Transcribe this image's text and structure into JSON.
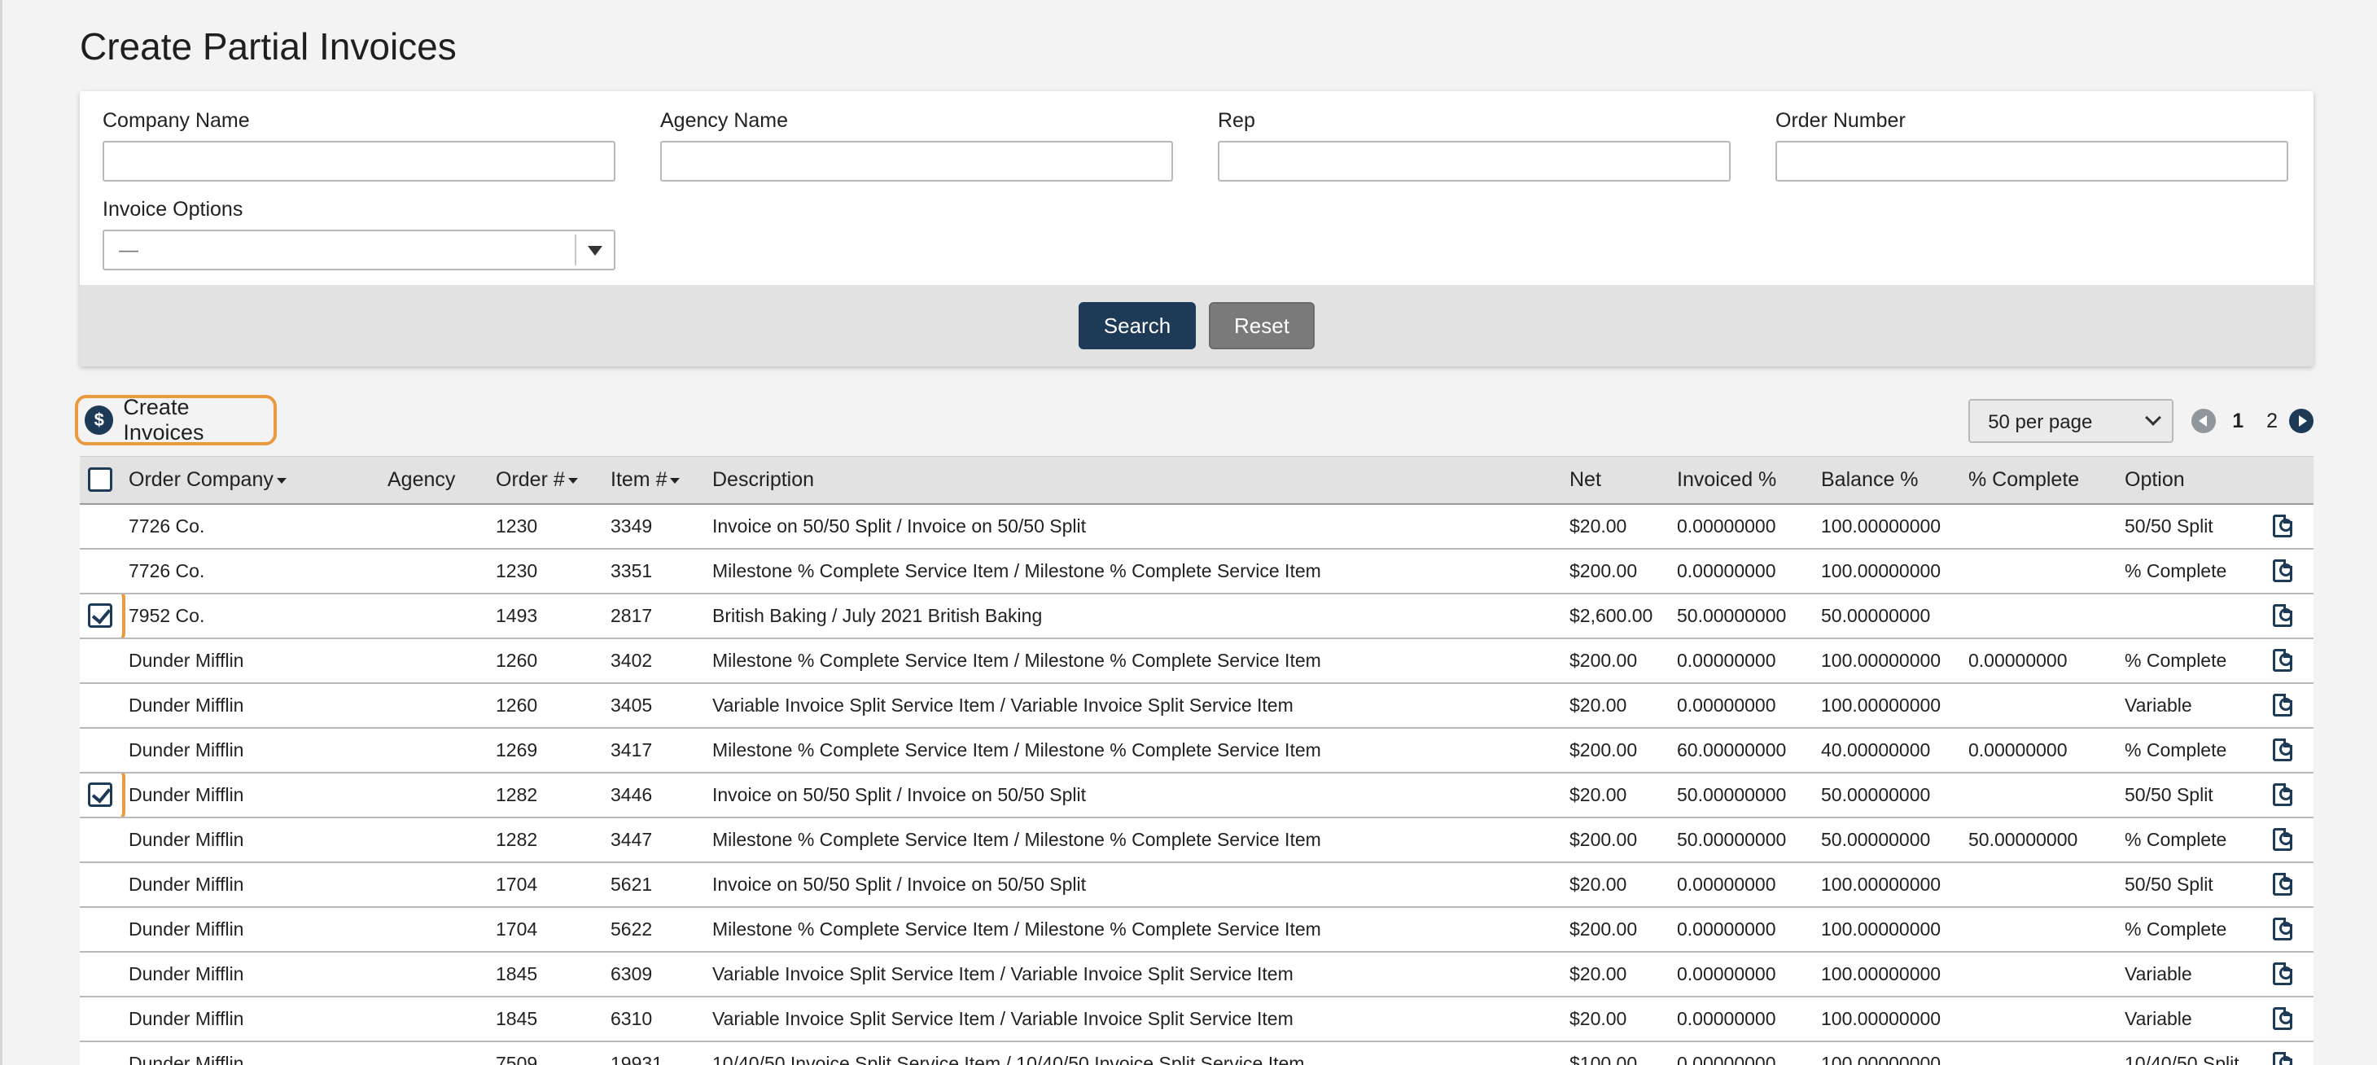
{
  "page": {
    "title": "Create Partial Invoices"
  },
  "search_form": {
    "fields": [
      {
        "label": "Company Name",
        "value": "",
        "placeholder": ""
      },
      {
        "label": "Agency Name",
        "value": "",
        "placeholder": ""
      },
      {
        "label": "Rep",
        "value": "",
        "placeholder": ""
      },
      {
        "label": "Order Number",
        "value": "",
        "placeholder": ""
      }
    ],
    "invoice_options": {
      "label": "Invoice Options",
      "selected": "—"
    },
    "search_label": "Search",
    "reset_label": "Reset"
  },
  "toolbar": {
    "create_invoices_label": "Create Invoices",
    "per_page": "50 per page",
    "pages": [
      "1",
      "2"
    ],
    "current_page": "1"
  },
  "table": {
    "headers": [
      "Order Company",
      "Agency",
      "Order #",
      "Item #",
      "Description",
      "Net",
      "Invoiced %",
      "Balance %",
      "% Complete",
      "Option"
    ],
    "rows": [
      {
        "checked": false,
        "company": "7726 Co.",
        "agency": "",
        "order": "1230",
        "item": "3349",
        "description": "Invoice on 50/50 Split / Invoice on 50/50 Split",
        "net": "$20.00",
        "invoiced": "0.00000000",
        "balance": "100.00000000",
        "complete": "",
        "option": "50/50 Split"
      },
      {
        "checked": false,
        "company": "7726 Co.",
        "agency": "",
        "order": "1230",
        "item": "3351",
        "description": "Milestone % Complete Service Item / Milestone % Complete Service Item",
        "net": "$200.00",
        "invoiced": "0.00000000",
        "balance": "100.00000000",
        "complete": "",
        "option": "% Complete"
      },
      {
        "checked": true,
        "company": "7952 Co.",
        "agency": "",
        "order": "1493",
        "item": "2817",
        "description": "British Baking / July 2021 British Baking",
        "net": "$2,600.00",
        "invoiced": "50.00000000",
        "balance": "50.00000000",
        "complete": "",
        "option": ""
      },
      {
        "checked": false,
        "company": "Dunder Mifflin",
        "agency": "",
        "order": "1260",
        "item": "3402",
        "description": "Milestone % Complete Service Item / Milestone % Complete Service Item",
        "net": "$200.00",
        "invoiced": "0.00000000",
        "balance": "100.00000000",
        "complete": "0.00000000",
        "option": "% Complete"
      },
      {
        "checked": false,
        "company": "Dunder Mifflin",
        "agency": "",
        "order": "1260",
        "item": "3405",
        "description": "Variable Invoice Split Service Item / Variable Invoice Split Service Item",
        "net": "$20.00",
        "invoiced": "0.00000000",
        "balance": "100.00000000",
        "complete": "",
        "option": "Variable"
      },
      {
        "checked": false,
        "company": "Dunder Mifflin",
        "agency": "",
        "order": "1269",
        "item": "3417",
        "description": "Milestone % Complete Service Item / Milestone % Complete Service Item",
        "net": "$200.00",
        "invoiced": "60.00000000",
        "balance": "40.00000000",
        "complete": "0.00000000",
        "option": "% Complete"
      },
      {
        "checked": true,
        "company": "Dunder Mifflin",
        "agency": "",
        "order": "1282",
        "item": "3446",
        "description": "Invoice on 50/50 Split / Invoice on 50/50 Split",
        "net": "$20.00",
        "invoiced": "50.00000000",
        "balance": "50.00000000",
        "complete": "",
        "option": "50/50 Split"
      },
      {
        "checked": false,
        "company": "Dunder Mifflin",
        "agency": "",
        "order": "1282",
        "item": "3447",
        "description": "Milestone % Complete Service Item / Milestone % Complete Service Item",
        "net": "$200.00",
        "invoiced": "50.00000000",
        "balance": "50.00000000",
        "complete": "50.00000000",
        "option": "% Complete"
      },
      {
        "checked": false,
        "company": "Dunder Mifflin",
        "agency": "",
        "order": "1704",
        "item": "5621",
        "description": "Invoice on 50/50 Split / Invoice on 50/50 Split",
        "net": "$20.00",
        "invoiced": "0.00000000",
        "balance": "100.00000000",
        "complete": "",
        "option": "50/50 Split"
      },
      {
        "checked": false,
        "company": "Dunder Mifflin",
        "agency": "",
        "order": "1704",
        "item": "5622",
        "description": "Milestone % Complete Service Item / Milestone % Complete Service Item",
        "net": "$200.00",
        "invoiced": "0.00000000",
        "balance": "100.00000000",
        "complete": "",
        "option": "% Complete"
      },
      {
        "checked": false,
        "company": "Dunder Mifflin",
        "agency": "",
        "order": "1845",
        "item": "6309",
        "description": "Variable Invoice Split Service Item / Variable Invoice Split Service Item",
        "net": "$20.00",
        "invoiced": "0.00000000",
        "balance": "100.00000000",
        "complete": "",
        "option": "Variable"
      },
      {
        "checked": false,
        "company": "Dunder Mifflin",
        "agency": "",
        "order": "1845",
        "item": "6310",
        "description": "Variable Invoice Split Service Item / Variable Invoice Split Service Item",
        "net": "$20.00",
        "invoiced": "0.00000000",
        "balance": "100.00000000",
        "complete": "",
        "option": "Variable"
      },
      {
        "checked": false,
        "company": "Dunder Mifflin",
        "agency": "",
        "order": "7509",
        "item": "19931",
        "description": "10/40/50 Invoice Split Service Item / 10/40/50 Invoice Split Service Item",
        "net": "$100.00",
        "invoiced": "0.00000000",
        "balance": "100.00000000",
        "complete": "",
        "option": "10/40/50 Split"
      }
    ]
  },
  "colors": {
    "primary": "#1d3a57",
    "highlight": "#e99a3e",
    "reset": "#7a7a7a"
  }
}
